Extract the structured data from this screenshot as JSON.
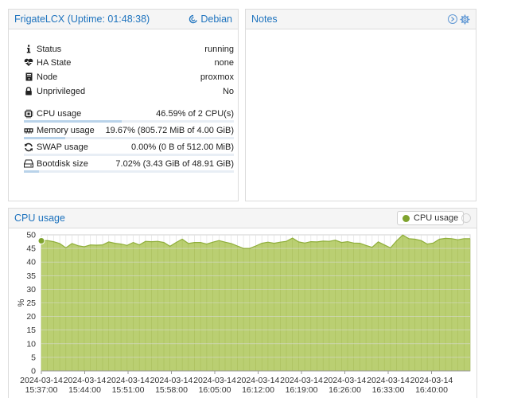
{
  "summary": {
    "title": "FrigateLCX (Uptime: 01:48:38)",
    "os_label": "Debian",
    "rows": [
      {
        "label": "Status",
        "value": "running",
        "icon": "info-icon"
      },
      {
        "label": "HA State",
        "value": "none",
        "icon": "heartbeat-icon"
      },
      {
        "label": "Node",
        "value": "proxmox",
        "icon": "server-icon"
      },
      {
        "label": "Unprivileged",
        "value": "No",
        "icon": "lock-icon"
      }
    ],
    "usage": [
      {
        "label": "CPU usage",
        "value": "46.59% of 2 CPU(s)",
        "icon": "cpu-icon",
        "fraction": 0.4659
      },
      {
        "label": "Memory usage",
        "value": "19.67% (805.72 MiB of 4.00 GiB)",
        "icon": "memory-icon",
        "fraction": 0.1967
      },
      {
        "label": "SWAP usage",
        "value": "0.00% (0 B of 512.00 MiB)",
        "icon": "swap-icon",
        "fraction": 0.0
      },
      {
        "label": "Bootdisk size",
        "value": "7.02% (3.43 GiB of 48.91 GiB)",
        "icon": "disk-icon",
        "fraction": 0.0702
      }
    ]
  },
  "notes": {
    "title": "Notes"
  },
  "cpu_panel": {
    "title": "CPU usage"
  },
  "colors": {
    "accent": "#1e73be",
    "area_fill": "#b6cc6a",
    "area_line": "#8fae3a",
    "legend_dot": "#7fa32e"
  },
  "chart_data": {
    "type": "area",
    "ylabel": "%",
    "ylim": [
      0,
      50
    ],
    "yticks": [
      0,
      5,
      10,
      15,
      20,
      25,
      30,
      35,
      40,
      45,
      50
    ],
    "xtick_labels": [
      [
        "2024-03-14",
        "15:37:00"
      ],
      [
        "2024-03-14",
        "15:44:00"
      ],
      [
        "2024-03-14",
        "15:51:00"
      ],
      [
        "2024-03-14",
        "15:58:00"
      ],
      [
        "2024-03-14",
        "16:05:00"
      ],
      [
        "2024-03-14",
        "16:12:00"
      ],
      [
        "2024-03-14",
        "16:19:00"
      ],
      [
        "2024-03-14",
        "16:26:00"
      ],
      [
        "2024-03-14",
        "16:33:00"
      ],
      [
        "2024-03-14",
        "16:40:00"
      ]
    ],
    "grid": true,
    "legend": "top-right",
    "series": [
      {
        "name": "CPU usage",
        "values": [
          47.8,
          47.9,
          47.5,
          46.8,
          45.2,
          46.8,
          46.0,
          45.6,
          46.3,
          46.2,
          46.3,
          47.4,
          46.9,
          46.6,
          46.1,
          47.2,
          46.3,
          47.6,
          47.5,
          47.6,
          47.2,
          45.8,
          47.2,
          48.4,
          46.8,
          47.2,
          47.2,
          46.6,
          47.3,
          47.9,
          47.3,
          46.8,
          45.9,
          45.0,
          45.0,
          45.9,
          46.9,
          47.3,
          46.9,
          47.3,
          47.6,
          48.8,
          47.4,
          47.0,
          47.5,
          47.4,
          47.7,
          47.6,
          48.0,
          47.2,
          47.5,
          47.0,
          46.9,
          46.1,
          45.4,
          47.4,
          46.3,
          45.2,
          47.8,
          49.9,
          48.6,
          48.4,
          47.9,
          46.6,
          47.0,
          48.4,
          48.7,
          48.6,
          48.2,
          48.6,
          48.6
        ]
      }
    ]
  }
}
